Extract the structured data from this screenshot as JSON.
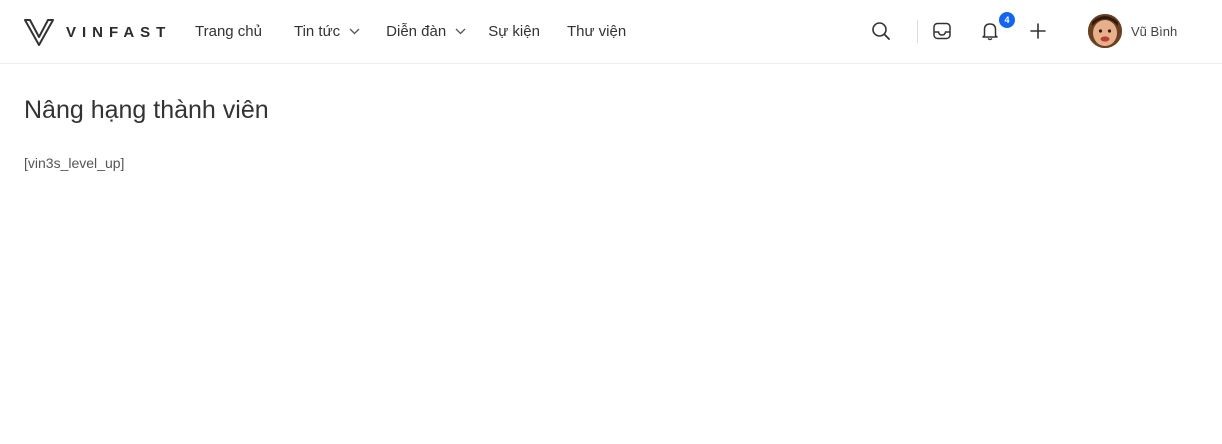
{
  "brand": {
    "name": "VINFAST",
    "logo_icon": "vinfast-v-logo-icon"
  },
  "nav": {
    "items": [
      {
        "label": "Trang chủ",
        "has_dropdown": false
      },
      {
        "label": "Tin tức",
        "has_dropdown": true
      },
      {
        "label": "Diễn đàn",
        "has_dropdown": true
      },
      {
        "label": "Sự kiện",
        "has_dropdown": false
      },
      {
        "label": "Thư viện",
        "has_dropdown": false
      }
    ]
  },
  "header_actions": {
    "search_icon": "search-icon",
    "inbox_icon": "inbox-icon",
    "notifications_icon": "bell-icon",
    "notification_count": "4",
    "create_icon": "plus-icon"
  },
  "user": {
    "name": "Vũ Bình",
    "avatar_icon": "avatar"
  },
  "main": {
    "title": "Nâng hạng thành viên",
    "shortcode": "[vin3s_level_up]"
  },
  "colors": {
    "badge": "#1464f4",
    "text": "#333333",
    "border": "#eeeeee"
  }
}
